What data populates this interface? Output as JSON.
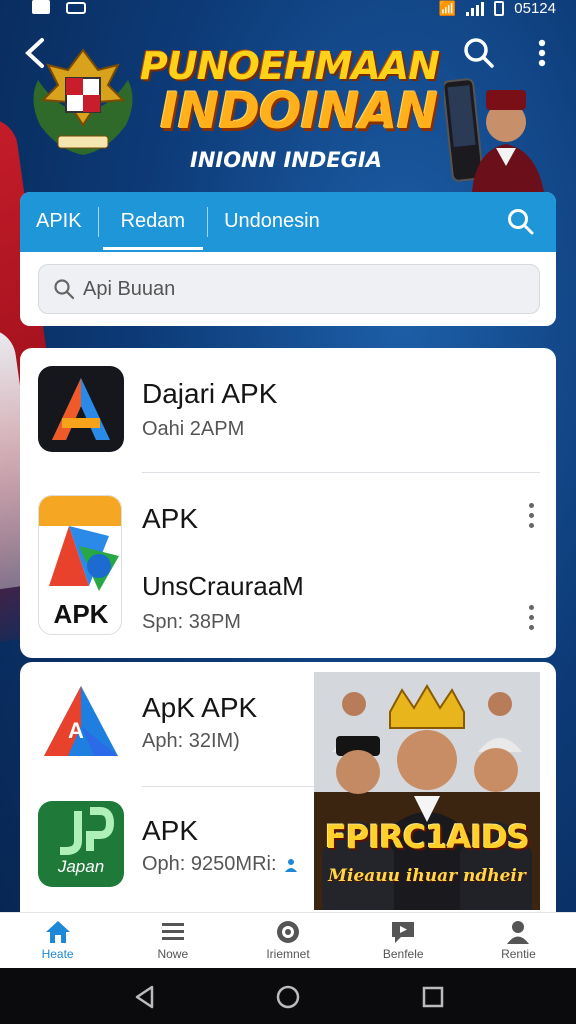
{
  "status_bar": {
    "time": "05124"
  },
  "header": {
    "title_line1": "PUNOEHMAAN",
    "title_line2": "INDOINAN",
    "subtitle": "INIONN INDEGIA"
  },
  "tabs": [
    {
      "label": "APIK"
    },
    {
      "label": "Redam"
    },
    {
      "label": "Undonesin"
    }
  ],
  "search": {
    "value": "Api Buuan"
  },
  "apps": [
    {
      "name": "Dajari APK",
      "meta": "Oahi 2APM"
    },
    {
      "name": "APK",
      "meta": ""
    },
    {
      "name": "UnsCrauraaM",
      "meta": "Spn: 38PM"
    },
    {
      "name": "ApK APK",
      "meta": "Aph: 32IM)"
    },
    {
      "name": "APK",
      "meta": "Oph: 9250MRi:"
    }
  ],
  "icon_texts": {
    "apk_badge": "APK",
    "japan_label": "Japan"
  },
  "poster": {
    "title": "FPIRC1AIDS",
    "subtitle": "Mieauu ihuar ndheir"
  },
  "bottom_nav": [
    {
      "label": "Heate",
      "icon": "home-icon"
    },
    {
      "label": "Nowe",
      "icon": "menu-icon"
    },
    {
      "label": "Iriemnet",
      "icon": "shield-icon"
    },
    {
      "label": "Benfele",
      "icon": "chat-icon"
    },
    {
      "label": "Rentie",
      "icon": "person-icon"
    }
  ],
  "colors": {
    "accent": "#1e96d8",
    "nav_active": "#1e88d8",
    "title_gold": "#ffb01a",
    "background": "#0d3b78"
  }
}
